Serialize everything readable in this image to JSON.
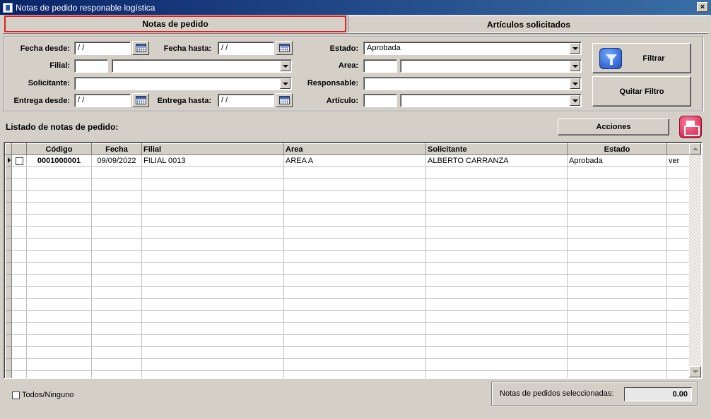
{
  "window": {
    "title": "Notas de pedido responable logística",
    "close_label": "×"
  },
  "tabs": [
    {
      "label": "Notas de pedido",
      "active": true
    },
    {
      "label": "Artículos solicitados",
      "active": false
    }
  ],
  "filters": {
    "fecha_desde": {
      "label": "Fecha desde:",
      "value": " / /"
    },
    "fecha_hasta": {
      "label": "Fecha hasta:",
      "value": " / /"
    },
    "filial": {
      "label": "Filial:",
      "code": "",
      "value": ""
    },
    "solicitante": {
      "label": "Solicitante:",
      "value": ""
    },
    "entrega_desde": {
      "label": "Entrega desde:",
      "value": " / /"
    },
    "entrega_hasta": {
      "label": "Entrega hasta:",
      "value": " / /"
    },
    "estado": {
      "label": "Estado:",
      "value": "Aprobada"
    },
    "area": {
      "label": "Area:",
      "code": "",
      "value": ""
    },
    "responsable": {
      "label": "Responsable:",
      "value": ""
    },
    "articulo": {
      "label": "Artículo:",
      "code": "",
      "value": ""
    },
    "filtrar_label": "Filtrar",
    "quitar_filtro_label": "Quitar Filtro"
  },
  "list": {
    "title": "Listado de notas de pedido:",
    "acciones_label": "Acciones",
    "columns": [
      "Código",
      "Fecha",
      "Filial",
      "Area",
      "Solicitante",
      "Estado"
    ],
    "rows": [
      {
        "codigo": "0001000001",
        "fecha": "09/09/2022",
        "filial": "FILIAL 0013",
        "area": "AREA A",
        "solicitante": "ALBERTO CARRANZA",
        "estado": "Aprobada",
        "action": "ver"
      }
    ]
  },
  "footer": {
    "todos_label": "Todos/Ninguno",
    "seleccionadas_label": "Notas de pedidos seleccionadas:",
    "seleccionadas_value": "0.00"
  },
  "colors": {
    "title_start": "#0a246a",
    "title_end": "#3a6ea5",
    "active_tab_border": "#e02020",
    "face": "#d4d0c8"
  }
}
